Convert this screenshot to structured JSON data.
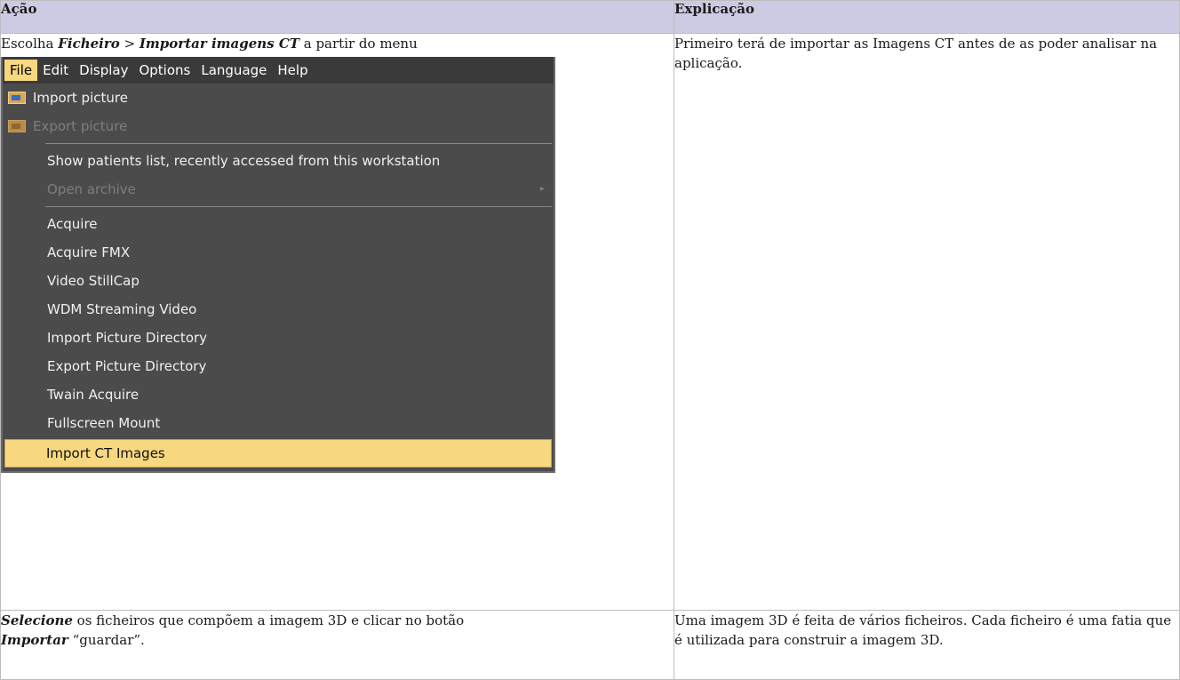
{
  "header": {
    "col1": "Ação",
    "col2": "Explicação"
  },
  "row1": {
    "instr_prefix": "Escolha ",
    "instr_menu1": "Ficheiro",
    "instr_sep": " > ",
    "instr_menu2": "Importar imagens CT",
    "instr_suffix": " a partir do menu",
    "explanation": "Primeiro terá de importar as Imagens CT antes de as poder analisar na aplicação."
  },
  "menu": {
    "bar": [
      "File",
      "Edit",
      "Display",
      "Options",
      "Language",
      "Help"
    ],
    "items": {
      "import_picture": "Import picture",
      "export_picture": "Export picture",
      "show_patients": "Show patients list, recently accessed from this workstation",
      "open_archive": "Open archive",
      "acquire": "Acquire",
      "acquire_fmx": "Acquire FMX",
      "video_stillcap": "Video StillCap",
      "wdm_streaming": "WDM Streaming Video",
      "import_dir": "Import Picture Directory",
      "export_dir": "Export Picture Directory",
      "twain": "Twain Acquire",
      "fullscreen": "Fullscreen Mount",
      "import_ct": "Import CT Images"
    },
    "submenu_arrow": "▸",
    "colors": {
      "highlight": "#f7d780",
      "background": "#4b4b4b",
      "disabled": "#7e7e7e"
    }
  },
  "row2": {
    "line1_bold": "Selecione",
    "line1_rest": " os ficheiros que compõem a imagem 3D e clicar no botão",
    "line2_bold": "Importar",
    "line2_rest": " “guardar”.",
    "explanation": "Uma imagem 3D é feita de vários ficheiros. Cada ficheiro é uma fatia que é utilizada para construir a imagem 3D."
  }
}
